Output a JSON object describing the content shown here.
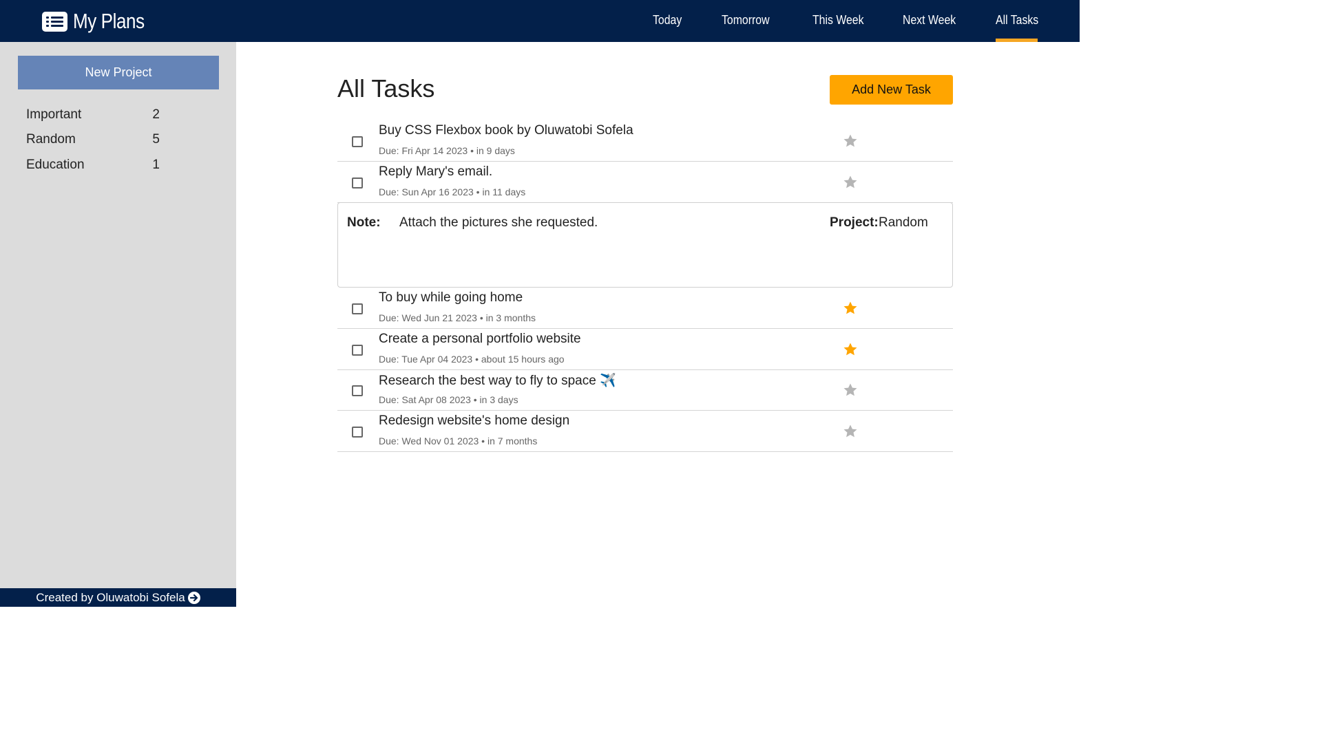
{
  "header": {
    "app_title": "My Plans",
    "nav": [
      "Today",
      "Tomorrow",
      "This Week",
      "Next Week",
      "All Tasks"
    ],
    "active_nav": "All Tasks",
    "accent_color": "#f5a623",
    "background_color": "#03204a"
  },
  "sidebar": {
    "new_project_label": "New Project",
    "projects": [
      {
        "name": "Important",
        "count": "2"
      },
      {
        "name": "Random",
        "count": "5"
      },
      {
        "name": "Education",
        "count": "1"
      }
    ],
    "footer_text": "Created by Oluwatobi Sofela"
  },
  "main": {
    "title": "All Tasks",
    "add_task_label": "Add New Task",
    "tasks": [
      {
        "title": "Buy CSS Flexbox book by Oluwatobi Sofela",
        "due": "Due: Fri Apr 14 2023 • in 9 days",
        "starred": false
      },
      {
        "title": "Reply Mary's email.",
        "due": "Due: Sun Apr 16 2023 • in 11 days",
        "starred": false
      },
      {
        "title": "To buy while going home",
        "due": "Due: Wed Jun 21 2023 • in 3 months",
        "starred": true
      },
      {
        "title": "Create a personal portfolio website",
        "due": "Due: Tue Apr 04 2023 • about 15 hours ago",
        "starred": true
      },
      {
        "title": "Research the best way to fly to space ✈️",
        "due": "Due: Sat Apr 08 2023 • in 3 days",
        "starred": false
      },
      {
        "title": "Redesign website's home design",
        "due": "Due: Wed Nov 01 2023 • in 7 months",
        "starred": false
      }
    ],
    "note": {
      "label": "Note:",
      "text": "Attach the pictures she requested.",
      "project_label": "Project:",
      "project_value": "Random"
    },
    "colors": {
      "star_on": "#ffa500",
      "star_off": "#b5b5b5"
    }
  }
}
